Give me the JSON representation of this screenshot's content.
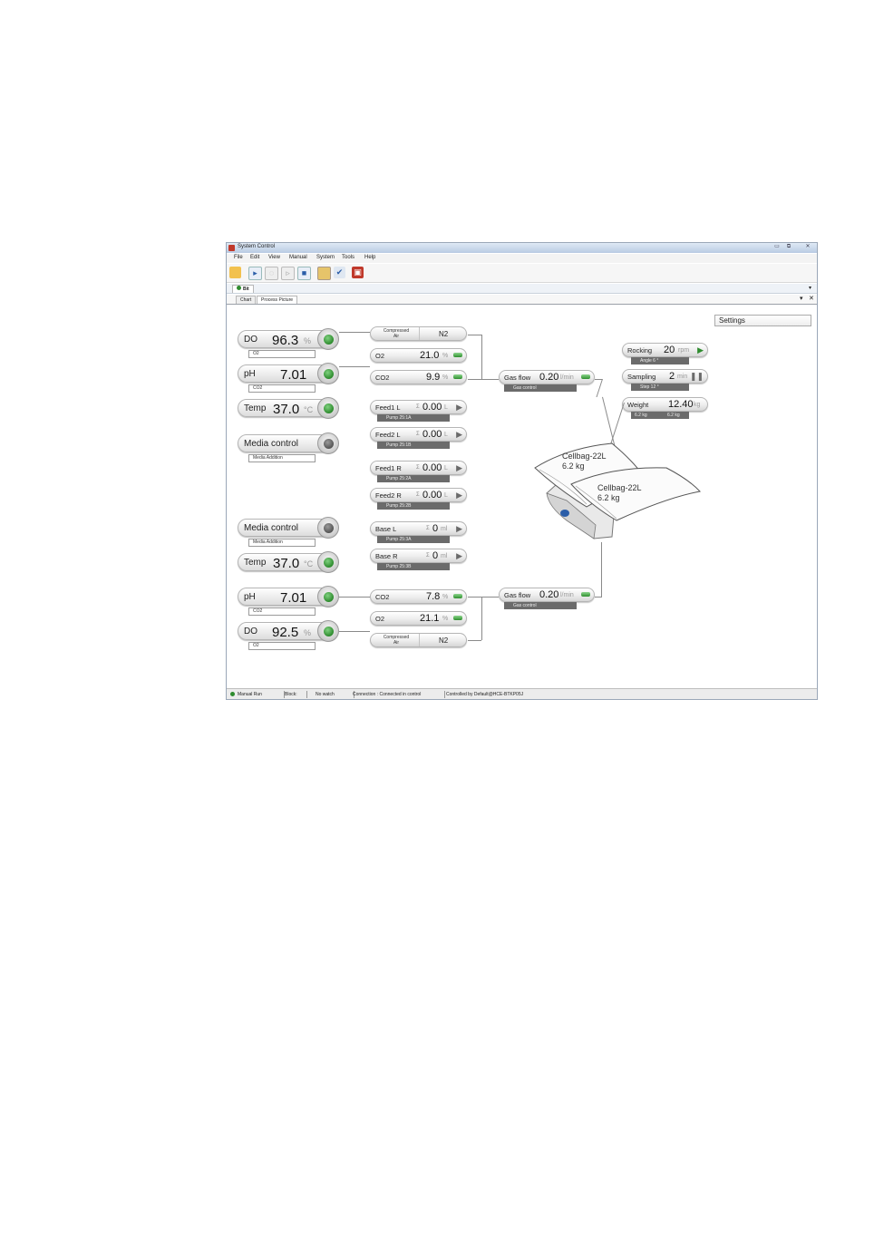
{
  "window": {
    "title": "System Control",
    "title_buttons": [
      "▭",
      "⧉",
      "✕"
    ]
  },
  "menu": [
    "File",
    "Edit",
    "View",
    "Manual",
    "System",
    "Tools",
    "Help"
  ],
  "toolbar_icons": [
    "open-folder-icon",
    "play-icon",
    "pause-icon",
    "step-icon",
    "stop-icon",
    "notebook-icon",
    "check-edit-icon",
    "system-icon"
  ],
  "system_tab": "Bit",
  "view_tabs": [
    "Chart",
    "Process Picture"
  ],
  "settings_label": "Settings",
  "left_top": {
    "do": {
      "label": "DO",
      "value": "96.3",
      "unit": "%",
      "sub": "O2"
    },
    "ph": {
      "label": "pH",
      "value": "7.01",
      "sub": "CO2"
    },
    "temp": {
      "label": "Temp",
      "value": "37.0",
      "unit": "°C"
    },
    "media": {
      "label": "Media control",
      "sub": "Media Addition"
    }
  },
  "left_bottom": {
    "media": {
      "label": "Media control",
      "sub": "Media Addition"
    },
    "temp": {
      "label": "Temp",
      "value": "37.0",
      "unit": "°C"
    },
    "ph": {
      "label": "pH",
      "value": "7.01",
      "sub": "CO2"
    },
    "do": {
      "label": "DO",
      "value": "92.5",
      "unit": "%",
      "sub": "O2"
    }
  },
  "gas_top": {
    "air_n2": {
      "top": "Compressed",
      "bottom": "Air",
      "right": "N2"
    },
    "o2": {
      "label": "O2",
      "value": "21.0",
      "unit": "%"
    },
    "co2": {
      "label": "CO2",
      "value": "9.9",
      "unit": "%"
    }
  },
  "pumps": [
    {
      "label": "Feed1 L",
      "sigma": "Σ",
      "value": "0.00",
      "unit": "L",
      "bar": "Pump 25:1A"
    },
    {
      "label": "Feed2 L",
      "sigma": "Σ",
      "value": "0.00",
      "unit": "L",
      "bar": "Pump 25:1B"
    },
    {
      "label": "Feed1 R",
      "sigma": "Σ",
      "value": "0.00",
      "unit": "L",
      "bar": "Pump 25:2A"
    },
    {
      "label": "Feed2 R",
      "sigma": "Σ",
      "value": "0.00",
      "unit": "L",
      "bar": "Pump 25:2B"
    },
    {
      "label": "Base L",
      "sigma": "Σ",
      "value": "0",
      "unit": "ml",
      "bar": "Pump 25:3A"
    },
    {
      "label": "Base R",
      "sigma": "Σ",
      "value": "0",
      "unit": "ml",
      "bar": "Pump 25:3B"
    }
  ],
  "gas_bottom": {
    "co2": {
      "label": "CO2",
      "value": "7.8",
      "unit": "%"
    },
    "o2": {
      "label": "O2",
      "value": "21.1",
      "unit": "%"
    },
    "air_n2": {
      "top": "Compressed",
      "bottom": "Air",
      "right": "N2"
    }
  },
  "gasflow_top": {
    "label": "Gas flow",
    "value": "0.20",
    "unit": "l/min",
    "bar": "Gas control"
  },
  "gasflow_bottom": {
    "label": "Gas flow",
    "value": "0.20",
    "unit": "l/min",
    "bar": "Gas control"
  },
  "rocker": {
    "rocking": {
      "label": "Rocking",
      "value": "20",
      "unit": "rpm",
      "bar": "Angle 6 °"
    },
    "sampling": {
      "label": "Sampling",
      "value": "2",
      "unit": "min",
      "bar": "Step 12 °"
    },
    "weight": {
      "label": "Weight",
      "value": "12.40",
      "unit": "kg",
      "bar_left": "6.2 kg",
      "bar_right": "6.2 kg"
    }
  },
  "bags": [
    {
      "name": "Cellbag-22L",
      "weight": "6.2 kg"
    },
    {
      "name": "Cellbag-22L",
      "weight": "6.2 kg"
    }
  ],
  "status": {
    "run": "Manual Run",
    "block": "Block:",
    "watch": "No watch",
    "connection": "Connection : Connected in control",
    "controlled": "Controlled by Default@HCE-BTKP05J"
  },
  "colors": {
    "indicator_green": "#2e8b2e",
    "indicator_grey": "#555555",
    "bar_dark": "#6b6b6b",
    "title_gradient": "#b9cbe3"
  }
}
